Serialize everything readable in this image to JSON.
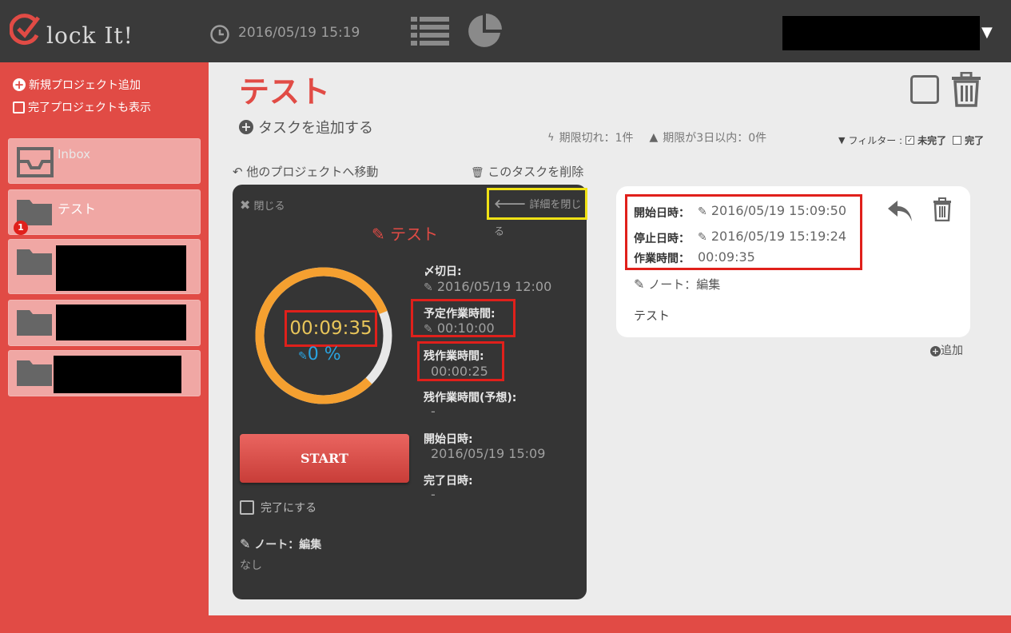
{
  "header": {
    "logo_text": "lock It!",
    "datetime": "2016/05/19 15:19",
    "caret": "▼"
  },
  "sidebar": {
    "add_project": "新規プロジェクト追加",
    "show_completed": "完了プロジェクトも表示",
    "projects": [
      {
        "label": "Inbox"
      },
      {
        "label": "テスト",
        "badge": "1"
      },
      {
        "label": ""
      },
      {
        "label": ""
      },
      {
        "label": ""
      }
    ]
  },
  "main": {
    "title": "テスト",
    "add_task": "タスクを追加する",
    "overdue": "期限切れ：1件",
    "due_soon": "期限が3日以内：0件",
    "filter_label": "フィルター :",
    "filter_incomplete": "未完了",
    "filter_complete": "完了",
    "move_link": "他のプロジェクトへ移動",
    "delete_link": "このタスクを削除"
  },
  "panel": {
    "close": "閉じる",
    "close_detail": "詳細を閉じる",
    "task_title": "テスト",
    "timer": "00:09:35",
    "percent": "0 %",
    "start_button": "START",
    "complete_label": "完了にする",
    "note_label": "ノート：編集",
    "note_value": "なし",
    "deadline_label": "〆切日:",
    "deadline_value": "2016/05/19 12:00",
    "planned_label": "予定作業時間:",
    "planned_value": "00:10:00",
    "remaining_label": "残作業時間:",
    "remaining_value": "00:00:25",
    "remaining_est_label": "残作業時間(予想):",
    "remaining_est_value": "-",
    "start_date_label": "開始日時:",
    "start_date_value": "2016/05/19 15:09",
    "end_date_label": "完了日時:",
    "end_date_value": "-",
    "progress_fraction": 0.96
  },
  "card": {
    "start_label": "開始日時：",
    "start_value": "2016/05/19 15:09:50",
    "stop_label": "停止日時：",
    "stop_value": "2016/05/19 15:19:24",
    "work_label": "作業時間：",
    "work_value": "00:09:35",
    "note_label": "ノート：編集",
    "text": "テスト",
    "add": "追加"
  },
  "colors": {
    "accent": "#e14b45",
    "highlight_red": "#e0201b",
    "highlight_yellow": "#f0e215",
    "ring_orange": "#f5a030"
  }
}
